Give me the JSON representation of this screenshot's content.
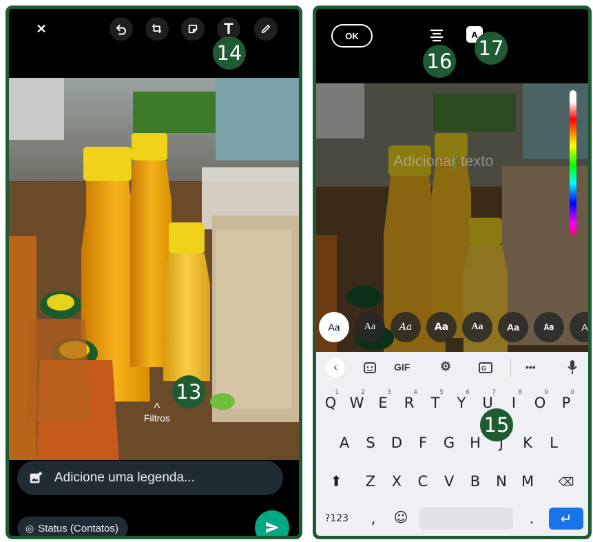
{
  "left_screen": {
    "toolbar": {
      "close": "✕",
      "undo": "↶",
      "text_tool": "T"
    },
    "callouts": {
      "toolbar": "14",
      "filters": "13"
    },
    "filters_label": "Filtros",
    "caption_placeholder": "Adicione uma legenda...",
    "status_label": "Status (Contatos)",
    "colors": {
      "send": "#00a884",
      "pill": "#1f2c34",
      "border": "#1e5a32"
    }
  },
  "right_screen": {
    "ok_label": "OK",
    "callouts": {
      "align": "16",
      "style": "17",
      "keyboard": "15"
    },
    "text_placeholder": "Adicionar texto",
    "font_options": [
      "Aa",
      "Aa",
      "Aa",
      "Aa",
      "Aa",
      "Aa",
      "Aa",
      "A"
    ],
    "keyboard": {
      "toolbar": {
        "gif": "GIF",
        "more": "•••"
      },
      "row1": [
        {
          "key": "Q",
          "num": "1"
        },
        {
          "key": "W",
          "num": "2"
        },
        {
          "key": "E",
          "num": "3"
        },
        {
          "key": "R",
          "num": "4"
        },
        {
          "key": "T",
          "num": "5"
        },
        {
          "key": "Y",
          "num": "6"
        },
        {
          "key": "U",
          "num": "7"
        },
        {
          "key": "I",
          "num": "8"
        },
        {
          "key": "O",
          "num": "9"
        },
        {
          "key": "P",
          "num": "0"
        }
      ],
      "row2": [
        "A",
        "S",
        "D",
        "F",
        "G",
        "H",
        "J",
        "K",
        "L"
      ],
      "row3": [
        "Z",
        "X",
        "C",
        "V",
        "B",
        "N",
        "M"
      ],
      "bottom": {
        "symbols": "?123",
        "comma": ",",
        "period": "."
      }
    }
  }
}
